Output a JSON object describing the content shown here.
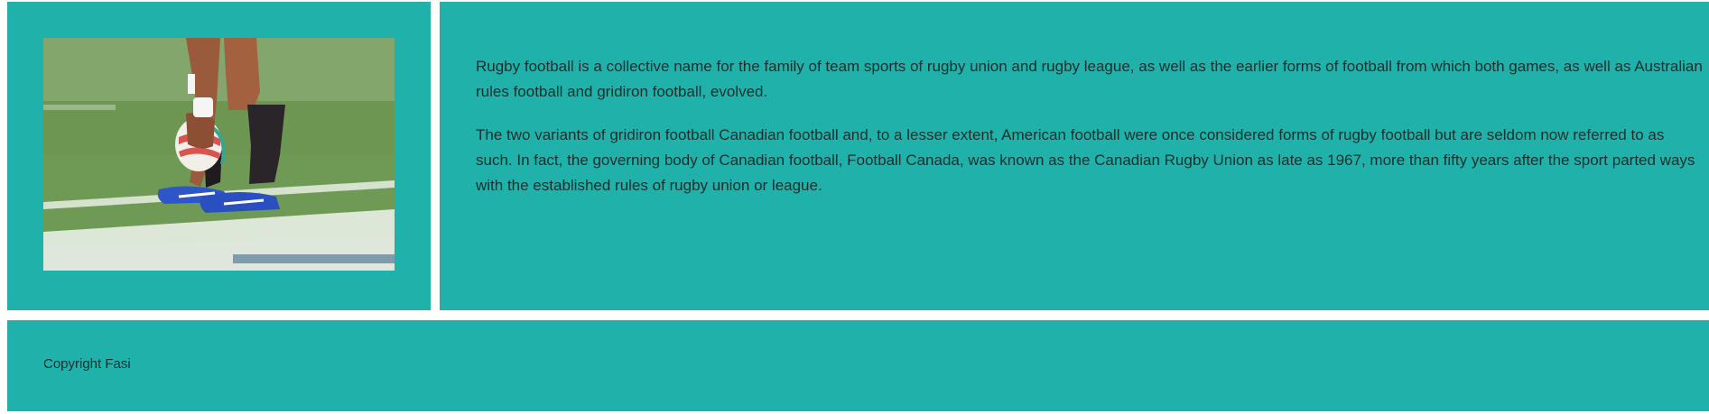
{
  "colors": {
    "panel_background": "#20b2aa",
    "page_background": "#ffffff",
    "text": "#10302e"
  },
  "image": {
    "alt": "rugby player placing ball",
    "icon": "rugby-photo"
  },
  "main": {
    "paragraphs": [
      "Rugby football is a collective name for the family of team sports of rugby union and rugby league, as well as the earlier forms of football from which both games, as well as Australian rules football and gridiron football, evolved.",
      "The two variants of gridiron football Canadian football and, to a lesser extent, American football were once considered forms of rugby football but are seldom now referred to as such. In fact, the governing body of Canadian football, Football Canada, was known as the Canadian Rugby Union as late as 1967, more than fifty years after the sport parted ways with the established rules of rugby union or league."
    ]
  },
  "footer": {
    "copyright": "Copyright Fasi"
  }
}
